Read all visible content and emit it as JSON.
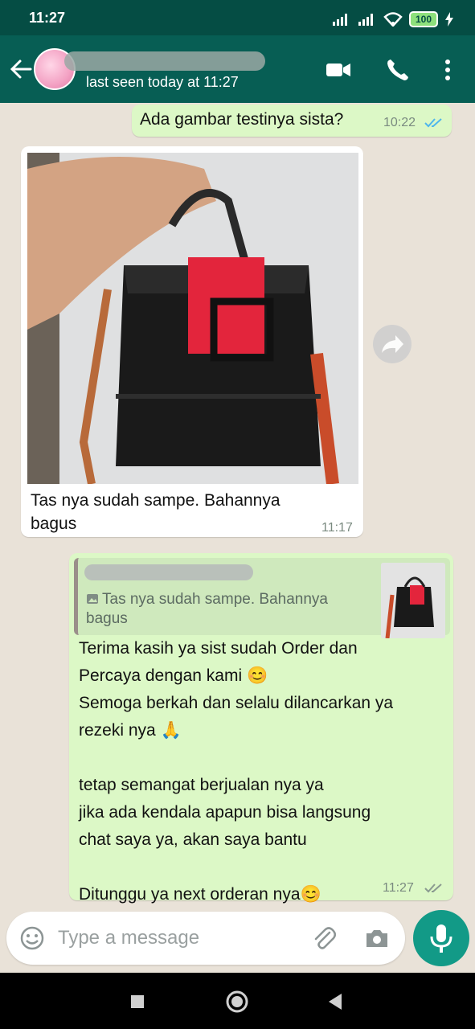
{
  "status_bar": {
    "time": "11:27",
    "battery": "100"
  },
  "header": {
    "last_seen": "last seen today at 11:27"
  },
  "messages": {
    "m1": {
      "text": "Ada gambar testinya sista?",
      "time": "10:22"
    },
    "m2": {
      "caption": "Tas nya sudah sampe. Bahannya\nbagus",
      "time": "11:17"
    },
    "m3": {
      "quote_text": "Tas nya sudah sampe. Bahannya\nbagus",
      "text": "Terima kasih ya sist sudah Order dan\nPercaya dengan kami 😊\nSemoga berkah dan selalu dilancarkan ya\nrezeki nya 🙏\n\ntetap semangat berjualan nya ya\njika ada kendala apapun bisa langsung\nchat saya ya, akan saya bantu\n\nDitunggu ya next orderan nya😊",
      "time": "11:27"
    }
  },
  "input": {
    "placeholder": "Type a message"
  },
  "colors": {
    "header": "#075e54",
    "out_bubble": "#dcf8c6",
    "in_bubble": "#ffffff",
    "accent": "#129a87",
    "read_tick": "#4fb6ec"
  },
  "icons": [
    "back-arrow-icon",
    "video-call-icon",
    "phone-icon",
    "more-vert-icon",
    "forward-icon",
    "emoji-icon",
    "attach-icon",
    "camera-icon",
    "mic-icon",
    "image-icon"
  ]
}
